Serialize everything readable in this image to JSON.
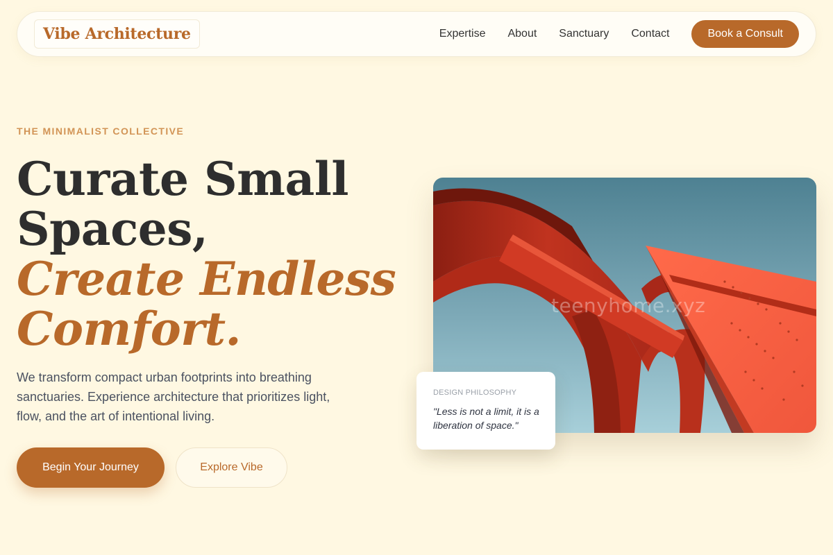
{
  "nav": {
    "logo": "Vibe Architecture",
    "links": [
      "Expertise",
      "About",
      "Sanctuary",
      "Contact"
    ],
    "cta": "Book a Consult"
  },
  "hero": {
    "eyebrow": "THE MINIMALIST COLLECTIVE",
    "headline": {
      "line1": "Curate Small",
      "line2": "Spaces,",
      "line3": "Create Endless",
      "line4": "Comfort."
    },
    "lede": "We transform compact urban footprints into breathing sanctuaries. Experience architecture that prioritizes light, flow, and the art of intentional living.",
    "primary_button": "Begin Your Journey",
    "secondary_button": "Explore Vibe"
  },
  "image": {
    "watermark": "teenyhome.xyz"
  },
  "quote_card": {
    "label": "DESIGN PHILOSOPHY",
    "text": "\"Less is not a limit, it is a liberation of space.\""
  },
  "colors": {
    "background": "#fff8e2",
    "accent": "#b8692a",
    "eyebrow": "#d29456",
    "text": "#2e2e2e"
  }
}
